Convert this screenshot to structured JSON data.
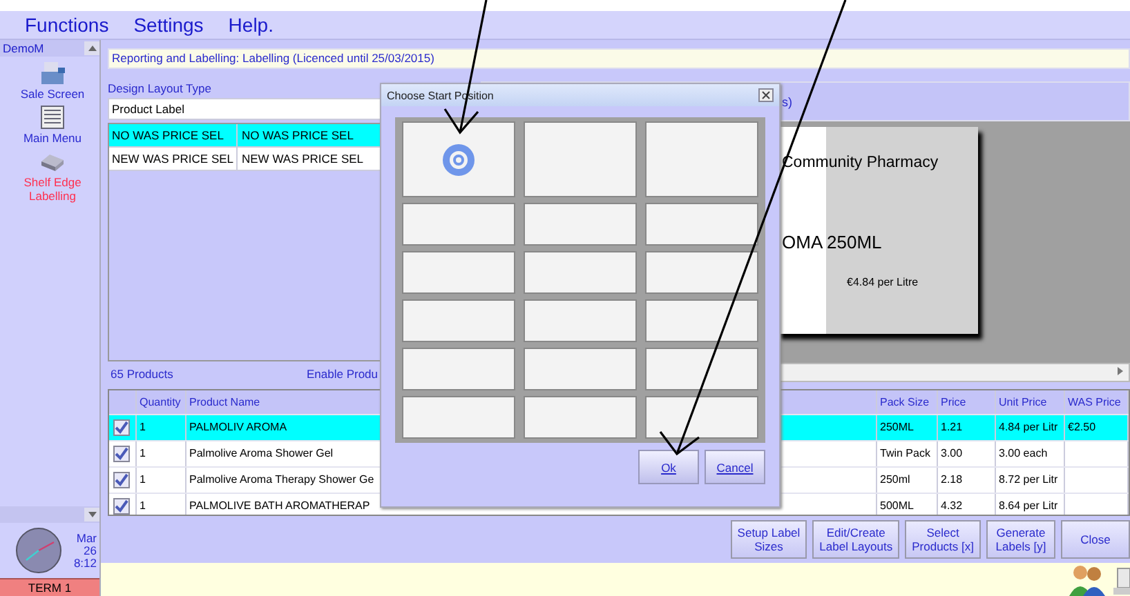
{
  "menu": [
    "Functions",
    "Settings",
    "Help."
  ],
  "sidebar": {
    "title": "DemoM",
    "items": [
      {
        "label": "Sale Screen",
        "kind": "register",
        "selected": false
      },
      {
        "label": "Main Menu",
        "kind": "list",
        "selected": false
      },
      {
        "label": "Shelf Edge Labelling",
        "kind": "printer",
        "selected": true
      }
    ],
    "clock": {
      "month": "Mar",
      "day": "26",
      "time": "8:12"
    },
    "terminal": "TERM 1"
  },
  "title_bar": "Reporting and Labelling: Labelling (Licenced until 25/03/2015)",
  "design_layout": {
    "label": "Design Layout Type",
    "value": "Product Label",
    "rows": [
      {
        "column_1": "NO WAS PRICE SEL",
        "column_2": "NO WAS PRICE SEL",
        "selected": true
      },
      {
        "column_1": "NEW WAS PRICE SEL",
        "column_2": "NEW WAS PRICE SEL",
        "selected": false
      }
    ]
  },
  "preview": {
    "tab_fragment": "s)",
    "label_card": {
      "shop": "Community Pharmacy",
      "product": "OMA 250ML",
      "unit_price": "€4.84 per Litre"
    }
  },
  "product_count": "65 Products",
  "enable_link": "Enable Produ",
  "products": {
    "columns": [
      "Quantity",
      "Product Name",
      "Pack Size",
      "Price",
      "Unit Price",
      "WAS Price"
    ],
    "rows": [
      {
        "checked": true,
        "selected": true,
        "cells": [
          "1",
          "PALMOLIV AROMA",
          "250ML",
          "1.21",
          "4.84 per Litr",
          "€2.50"
        ]
      },
      {
        "checked": true,
        "selected": false,
        "cells": [
          "1",
          "Palmolive Aroma Shower Gel",
          "Twin Pack",
          "3.00",
          "3.00 each",
          ""
        ]
      },
      {
        "checked": true,
        "selected": false,
        "cells": [
          "1",
          "Palmolive Aroma Therapy Shower Ge",
          "250ml",
          "2.18",
          "8.72 per Litr",
          ""
        ]
      },
      {
        "checked": true,
        "selected": false,
        "cells": [
          "1",
          "PALMOLIVE BATH AROMATHERAP",
          "500ML",
          "4.32",
          "8.64 per Litr",
          ""
        ]
      }
    ]
  },
  "buttons": [
    [
      "Setup Label",
      "Sizes"
    ],
    [
      "Edit/Create",
      "Label Layouts"
    ],
    [
      "Select",
      "Products [x]"
    ],
    [
      "Generate",
      "Labels [y]"
    ],
    [
      "Close"
    ]
  ],
  "dialog": {
    "title": "Choose Start Position",
    "positions": [
      {
        "selected": true
      },
      {
        "selected": false
      },
      {
        "selected": false
      },
      {
        "selected": false
      },
      {
        "selected": false
      },
      {
        "selected": false
      },
      {
        "selected": false
      },
      {
        "selected": false
      },
      {
        "selected": false
      },
      {
        "selected": false
      },
      {
        "selected": false
      },
      {
        "selected": false
      },
      {
        "selected": false
      },
      {
        "selected": false
      },
      {
        "selected": false
      },
      {
        "selected": false
      },
      {
        "selected": false
      },
      {
        "selected": false
      }
    ],
    "buttons": [
      "Ok",
      "Cancel"
    ]
  }
}
